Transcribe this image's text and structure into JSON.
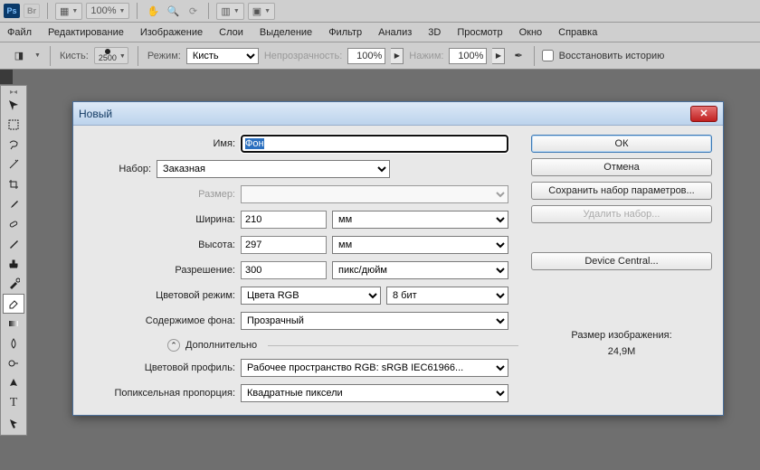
{
  "appbar": {
    "zoom": "100%",
    "launch_menu_icon": "film-icon"
  },
  "menubar": [
    "Файл",
    "Редактирование",
    "Изображение",
    "Слои",
    "Выделение",
    "Фильтр",
    "Анализ",
    "3D",
    "Просмотр",
    "Окно",
    "Справка"
  ],
  "optbar": {
    "brush_label": "Кисть:",
    "brush_size": "2500",
    "mode_label": "Режим:",
    "mode_value": "Кисть",
    "opacity_label": "Непрозрачность:",
    "opacity_value": "100%",
    "flow_label": "Нажим:",
    "flow_value": "100%",
    "history_checkbox": "Восстановить историю"
  },
  "dialog": {
    "title": "Новый",
    "labels": {
      "name": "Имя:",
      "preset": "Набор:",
      "size": "Размер:",
      "width": "Ширина:",
      "height": "Высота:",
      "resolution": "Разрешение:",
      "color_mode": "Цветовой режим:",
      "background": "Содержимое фона:",
      "advanced": "Дополнительно",
      "profile": "Цветовой профиль:",
      "pixel_aspect": "Попиксельная пропорция:"
    },
    "values": {
      "name": "Фон",
      "preset": "Заказная",
      "size": "",
      "width": "210",
      "width_unit": "мм",
      "height": "297",
      "height_unit": "мм",
      "resolution": "300",
      "resolution_unit": "пикс/дюйм",
      "color_mode": "Цвета RGB",
      "color_depth": "8 бит",
      "background": "Прозрачный",
      "profile": "Рабочее пространство RGB:  sRGB IEC61966...",
      "pixel_aspect": "Квадратные пиксели"
    },
    "buttons": {
      "ok": "ОК",
      "cancel": "Отмена",
      "save_preset": "Сохранить набор параметров...",
      "delete_preset": "Удалить набор...",
      "device_central": "Device Central..."
    },
    "size_info": {
      "label": "Размер изображения:",
      "value": "24,9M"
    }
  }
}
